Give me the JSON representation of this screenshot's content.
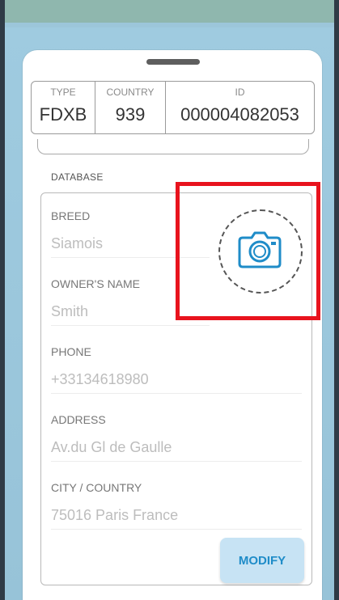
{
  "id_table": {
    "type": {
      "label": "TYPE",
      "value": "FDXB"
    },
    "country": {
      "label": "COUNTRY",
      "value": "939"
    },
    "id": {
      "label": "ID",
      "value": "000004082053"
    }
  },
  "section_title": "DATABASE",
  "fields": [
    {
      "label": "BREED",
      "value": "Siamois"
    },
    {
      "label": "OWNER'S NAME",
      "value": "Smith"
    },
    {
      "label": "PHONE",
      "value": "+33134618980"
    },
    {
      "label": "ADDRESS",
      "value": "Av.du Gl de Gaulle"
    },
    {
      "label": "CITY / COUNTRY",
      "value": "75016 Paris France"
    }
  ],
  "modify_label": "MODIFY",
  "colors": {
    "accent": "#1f8cc8",
    "button_bg": "#c7e3f4",
    "highlight": "#e8131d"
  },
  "icons": {
    "camera": "camera-icon"
  }
}
